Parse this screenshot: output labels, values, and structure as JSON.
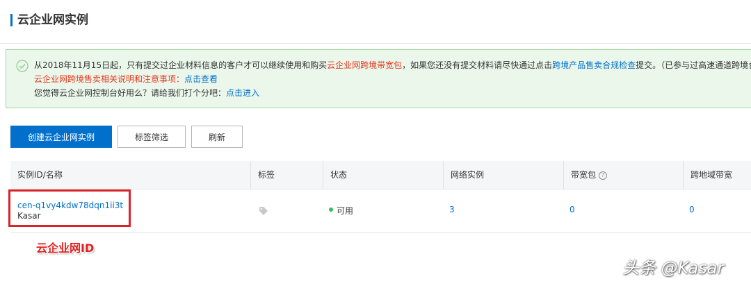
{
  "header": {
    "title": "云企业网实例"
  },
  "notice": {
    "line1_a": "从2018年11月15日起，只有提交过企业材料信息的客户才可以继续使用和购买",
    "line1_red": "云企业网跨境带宽包",
    "line1_b": "，如果您还没有提交材料请尽快通过点击",
    "line1_link": "跨境产品售卖合规检查",
    "line1_c": "提交。（已参与过高速通道跨境合",
    "line2_red": "云企业网跨境售卖相关说明和注意事项：",
    "line2_link": "点击查看",
    "line3_a": "您觉得云企业网控制台好用么？请给我们打个分吧：",
    "line3_link": "点击进入"
  },
  "toolbar": {
    "create_label": "创建云企业网实例",
    "tag_filter_label": "标签筛选",
    "refresh_label": "刷新"
  },
  "table": {
    "columns": [
      "实例ID/名称",
      "标签",
      "状态",
      "网络实例",
      "带宽包",
      "跨地域带宽"
    ],
    "rows": [
      {
        "id": "cen-q1vy4kdw78dqn1ii3t",
        "name": "Kasar",
        "status": "可用",
        "network_instances": "3",
        "bandwidth_packages": "0",
        "cross_region_bandwidth": "0"
      }
    ]
  },
  "annotation": {
    "label": "云企业网ID"
  },
  "watermark": {
    "text": "头条 @Kasar"
  },
  "colors": {
    "accent": "#0070cc",
    "status_available": "#2ebf5f",
    "warning_red": "#e5391f",
    "annotation_red": "#d9232b"
  }
}
